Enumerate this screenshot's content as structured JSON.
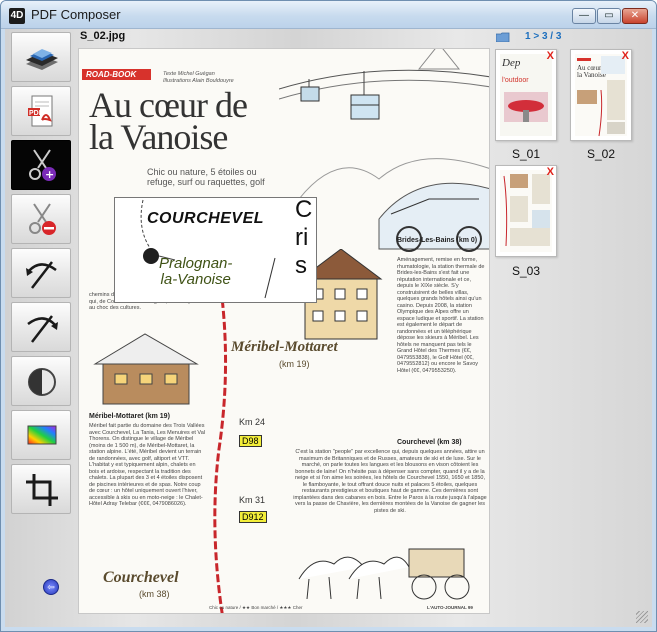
{
  "window": {
    "title": "PDF Composer",
    "min_glyph": "—",
    "max_glyph": "▭",
    "close_glyph": "✕"
  },
  "toolbar": {
    "tools": [
      {
        "name": "scanner-icon",
        "active": false
      },
      {
        "name": "pdf-icon",
        "active": false
      },
      {
        "name": "cut-add-icon",
        "active": true
      },
      {
        "name": "cut-remove-icon",
        "active": false
      },
      {
        "name": "rotate-left-icon",
        "active": false
      },
      {
        "name": "rotate-right-icon",
        "active": false
      },
      {
        "name": "contrast-icon",
        "active": false
      },
      {
        "name": "color-icon",
        "active": false
      },
      {
        "name": "crop-icon",
        "active": false
      }
    ],
    "back_glyph": "⇦"
  },
  "viewer": {
    "file_name": "S_02.jpg",
    "page": {
      "roadbook": "ROAD-BOOK",
      "credits": "Texte Michel Guégan\nIllustrations Alain Bouldouyre",
      "headline": "Au cœur de la Vanoise",
      "deck": "Chic ou nature, 5 étoiles ou refuge, surf ou raquettes, golf",
      "intro": "chemins de la Vanoise offrent une belle diversité, qui, de Courchevel à Pralognan, confine parfois au choc des cultures.",
      "brides_head": "Brides-Les-Bains (km 0)",
      "brides_body": "Aménagement, remise en forme, rhumatologie, la station thermale de Brides-les-Bains s'est fait une réputation internationale et ce, depuis le XIXe siècle. S'y construisirent de belles villas, quelques grands hôtels ainsi qu'un casino. Depuis 2008, la station Olympique des Alpes offre un espace ludique et sportif. La station est également le départ de randonnées et un téléphérique dépose les skieurs à Méribel. Les hôtels ne manquent pas tels le Grand Hôtel des Thermes (€€, 0479553838), le Golf Hôtel (€€, 0479552812) ou encore le Savoy Hôtel (€€, 0479553250).",
      "meribel_label": "Méribel-Mottaret",
      "meribel_km": "(km 19)",
      "meribel_head": "Méribel-Mottaret (km 19)",
      "meribel_body": "Méribel fait partie du domaine des Trois Vallées avec Courchevel, La Tania, Les Menuires et Val Thorens. On distingue le village de Méribel (moins de 1 500 m), de Méribel-Mottaret, la station alpine. L'été, Méribel devient un terrain de randonnées, avec golf, altiport et VTT. L'habitat y est typiquement alpin, chalets en bois et ardoise, respectant la tradition des chalets. La plupart des 3 et 4 étoiles disposent de piscines intérieures et de spas. Notre coup de cœur : un hôtel uniquement ouvert l'hiver, accessible à skis ou en moto-neige : le Chalet-Hôtel Adray Telebar (€€€, 0479086026).",
      "courchevel_head": "Courchevel (km 38)",
      "courchevel_body": "C'est la station \"people\" par excellence qui, depuis quelques années, attire un maximum de Britanniques et de Russes, amateurs de ski et de luxe. Sur le marché, on parle toutes les langues et les blousons en vison côtoient les bonnets de laine! On n'hésite pas à dépenser sans compter, quand il y a de la neige et si l'on aime les soirées, les hôtels de Courchevel 1550, 1650 et 1850, le flamboyante, le tout offrant douce nuits et palaces 5 étoiles, quelques restaurants prestigieux et boutiques haut de gamme. Ces dernières sont implantées dans des cabanes en bois. Entre le Paros à la route jusqu'à l'alpage vers la passe de Chavière, les dernières montées de la Vanoise de gagner les pistes de ski.",
      "km24": "Km 24",
      "d98": "D98",
      "km31": "Km 31",
      "d912": "D912",
      "courchevel_script": "Courchevel",
      "courchevel_km": "(km 38)",
      "footer_left": "Chic ou nature / ★★ Bon marché / ★★★ Cher",
      "footer_right": "L'AUTO-JOURNAL 99"
    },
    "zoom": {
      "line1": "COURCHEVEL",
      "line2": "Pralognan-\nla-Vanoise",
      "right_text": "C\nri\ns"
    }
  },
  "thumbnails": {
    "pager": "1 > 3 / 3",
    "items": [
      {
        "label": "S_01",
        "delete": "X"
      },
      {
        "label": "S_02",
        "delete": "X"
      },
      {
        "label": "S_03",
        "delete": "X"
      }
    ]
  },
  "colors": {
    "accent": "#1d6fbe",
    "delete": "#e0211a",
    "roadbook": "#d7322c"
  }
}
